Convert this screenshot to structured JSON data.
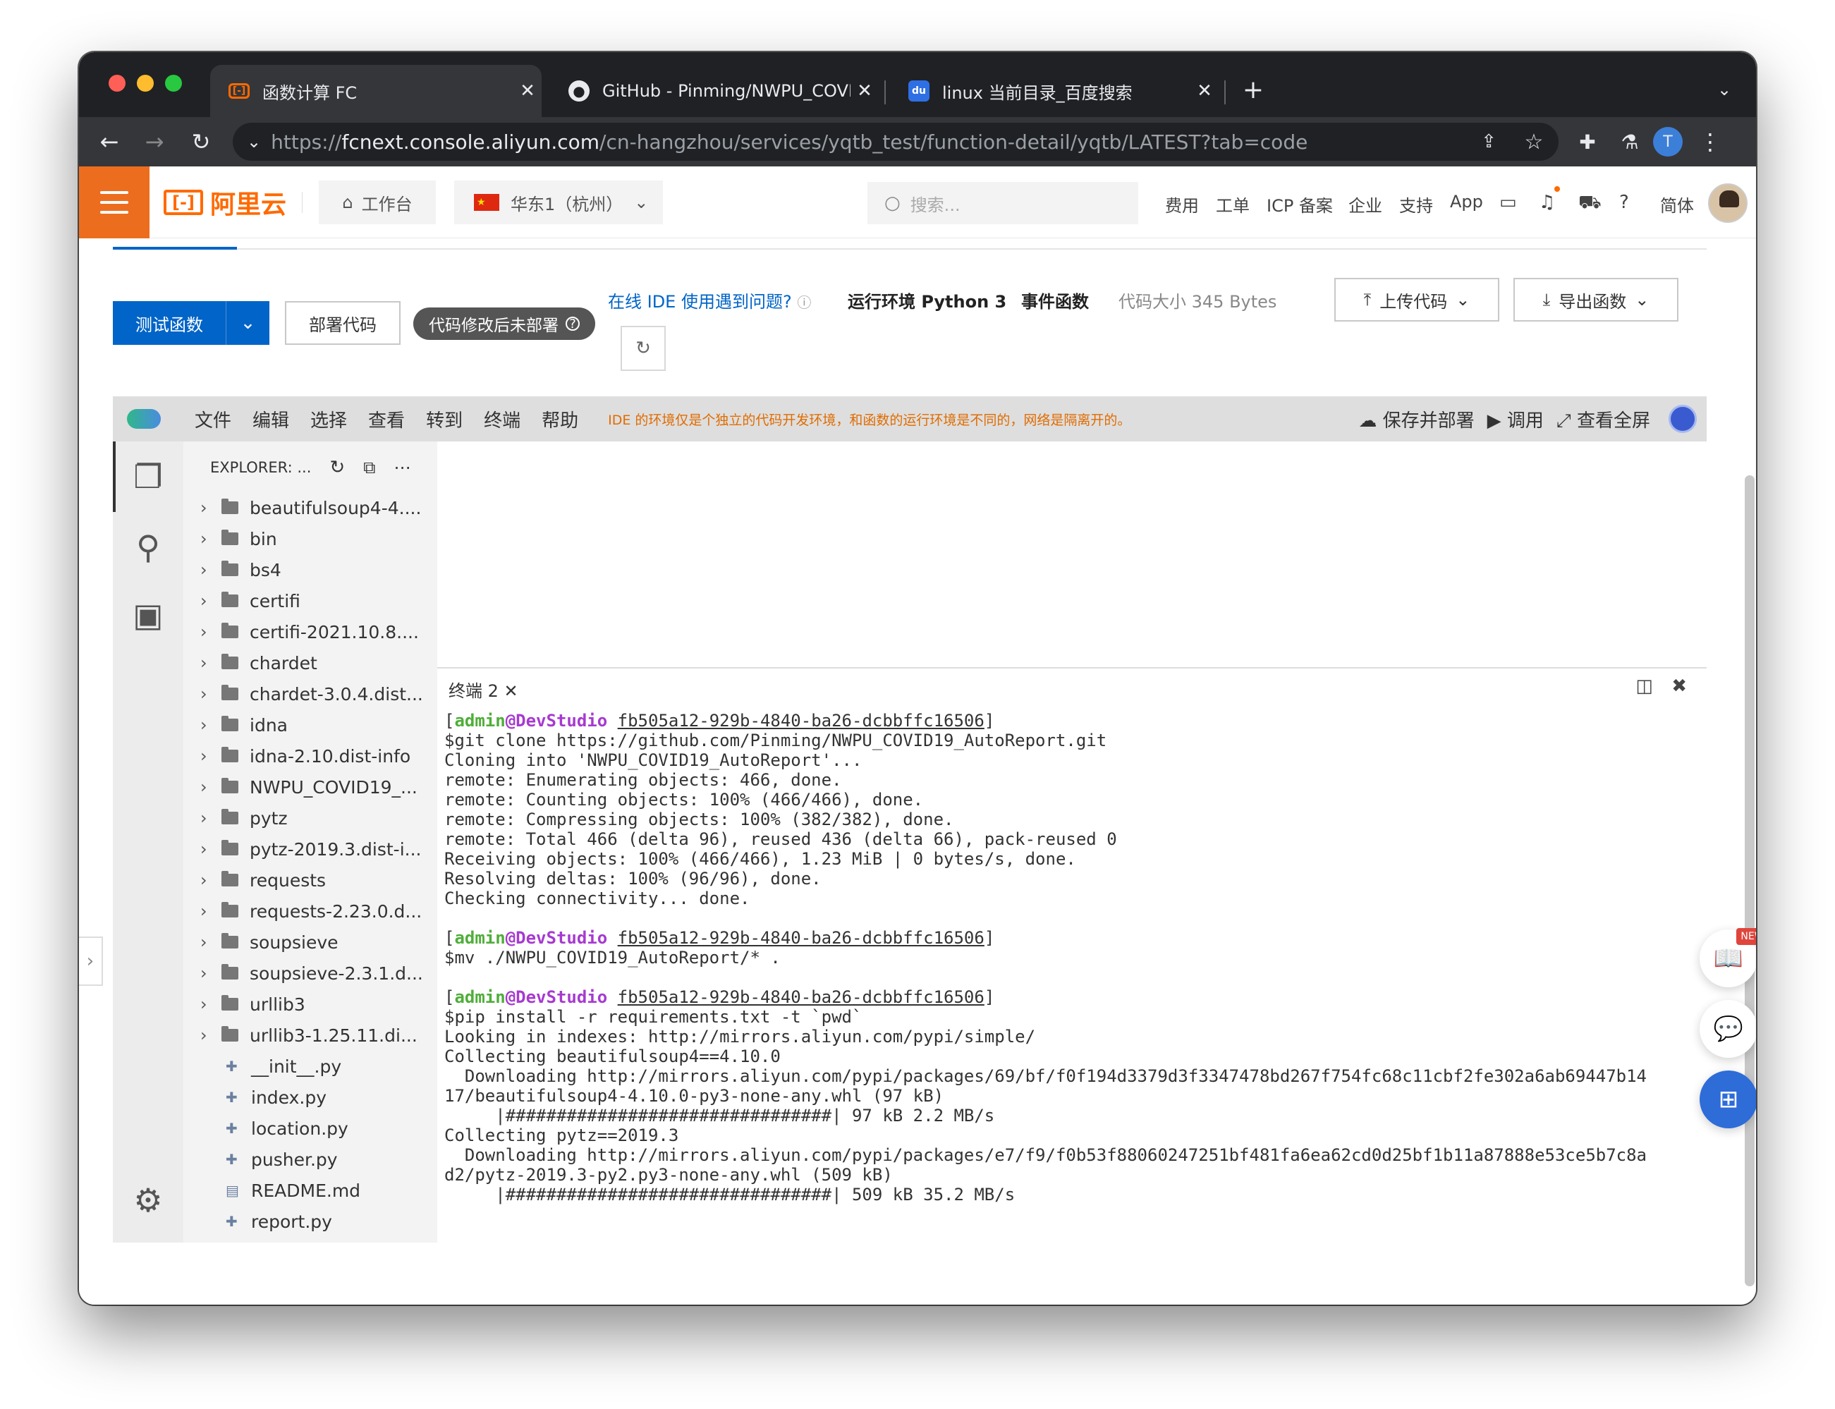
{
  "browser": {
    "tabs": [
      {
        "title": "函数计算 FC",
        "favicon": "aliyun-fc-icon"
      },
      {
        "title": "GitHub - Pinming/NWPU_COVI",
        "favicon": "github-icon"
      },
      {
        "title": "linux 当前目录_百度搜索",
        "favicon": "baidu-icon"
      }
    ],
    "url_prefix": "https://",
    "url_host": "fcnext.console.aliyun.com",
    "url_path": "/cn-hangzhou/services/yqtb_test/function-detail/yqtb/LATEST?tab=code",
    "profile_initial": "T"
  },
  "header": {
    "logo_text": "阿里云",
    "logo_mark": "[-]",
    "workbench": "工作台",
    "region": "华东1（杭州）",
    "search_placeholder": "搜索...",
    "links": [
      "费用",
      "工单",
      "ICP 备案",
      "企业",
      "支持",
      "App"
    ],
    "lang": "简体"
  },
  "toolbar": {
    "test_label": "测试函数",
    "deploy_label": "部署代码",
    "status_pill": "代码修改后未部署",
    "ide_help": "在线 IDE 使用遇到问题?",
    "runtime": "运行环境 Python 3",
    "trigger": "事件函数",
    "code_size": "代码大小 345 Bytes",
    "upload_label": "上传代码",
    "export_label": "导出函数"
  },
  "ide": {
    "menus": [
      "文件",
      "编辑",
      "选择",
      "查看",
      "转到",
      "终端",
      "帮助"
    ],
    "warning": "IDE 的环境仅是个独立的代码开发环境，和函数的运行环境是不同的，网络是隔离开的。",
    "save_deploy": "保存并部署",
    "invoke": "调用",
    "fullscreen": "查看全屏",
    "explorer_title": "EXPLORER: ...",
    "folders": [
      "beautifulsoup4-4....",
      "bin",
      "bs4",
      "certifi",
      "certifi-2021.10.8....",
      "chardet",
      "chardet-3.0.4.dist...",
      "idna",
      "idna-2.10.dist-info",
      "NWPU_COVID19_...",
      "pytz",
      "pytz-2019.3.dist-i...",
      "requests",
      "requests-2.23.0.d...",
      "soupsieve",
      "soupsieve-2.3.1.d...",
      "urllib3",
      "urllib3-1.25.11.di..."
    ],
    "files": [
      "__init__.py",
      "index.py",
      "location.py",
      "pusher.py",
      "README.md",
      "report.py"
    ],
    "terminal_tab": "终端 2",
    "prompt_user": "admin",
    "prompt_at": "@",
    "prompt_host": "DevStudio",
    "prompt_id": "fb505a12-929b-4840-ba26-dcbbffc16506",
    "block1": [
      "$git clone https://github.com/Pinming/NWPU_COVID19_AutoReport.git",
      "Cloning into 'NWPU_COVID19_AutoReport'...",
      "remote: Enumerating objects: 466, done.",
      "remote: Counting objects: 100% (466/466), done.",
      "remote: Compressing objects: 100% (382/382), done.",
      "remote: Total 466 (delta 96), reused 436 (delta 66), pack-reused 0",
      "Receiving objects: 100% (466/466), 1.23 MiB | 0 bytes/s, done.",
      "Resolving deltas: 100% (96/96), done.",
      "Checking connectivity... done."
    ],
    "block2": [
      "$mv ./NWPU_COVID19_AutoReport/* ."
    ],
    "block3": [
      "$pip install -r requirements.txt -t `pwd`",
      "Looking in indexes: http://mirrors.aliyun.com/pypi/simple/",
      "Collecting beautifulsoup4==4.10.0",
      "  Downloading http://mirrors.aliyun.com/pypi/packages/69/bf/f0f194d3379d3f3347478bd267f754fc68c11cbf2fe302a6ab69447b14",
      "17/beautifulsoup4-4.10.0-py3-none-any.whl (97 kB)",
      "     |################################| 97 kB 2.2 MB/s",
      "Collecting pytz==2019.3",
      "  Downloading http://mirrors.aliyun.com/pypi/packages/e7/f9/f0b53f88060247251bf481fa6ea62cd0d25bf1b11a87888e53ce5b7c8a",
      "d2/pytz-2019.3-py2.py3-none-any.whl (509 kB)",
      "     |################################| 509 kB 35.2 MB/s"
    ]
  },
  "floating": {
    "new_badge": "NEW"
  },
  "colors": {
    "accent": "#0064c8",
    "brand": "#ff6a00",
    "warning": "#e06c00"
  }
}
